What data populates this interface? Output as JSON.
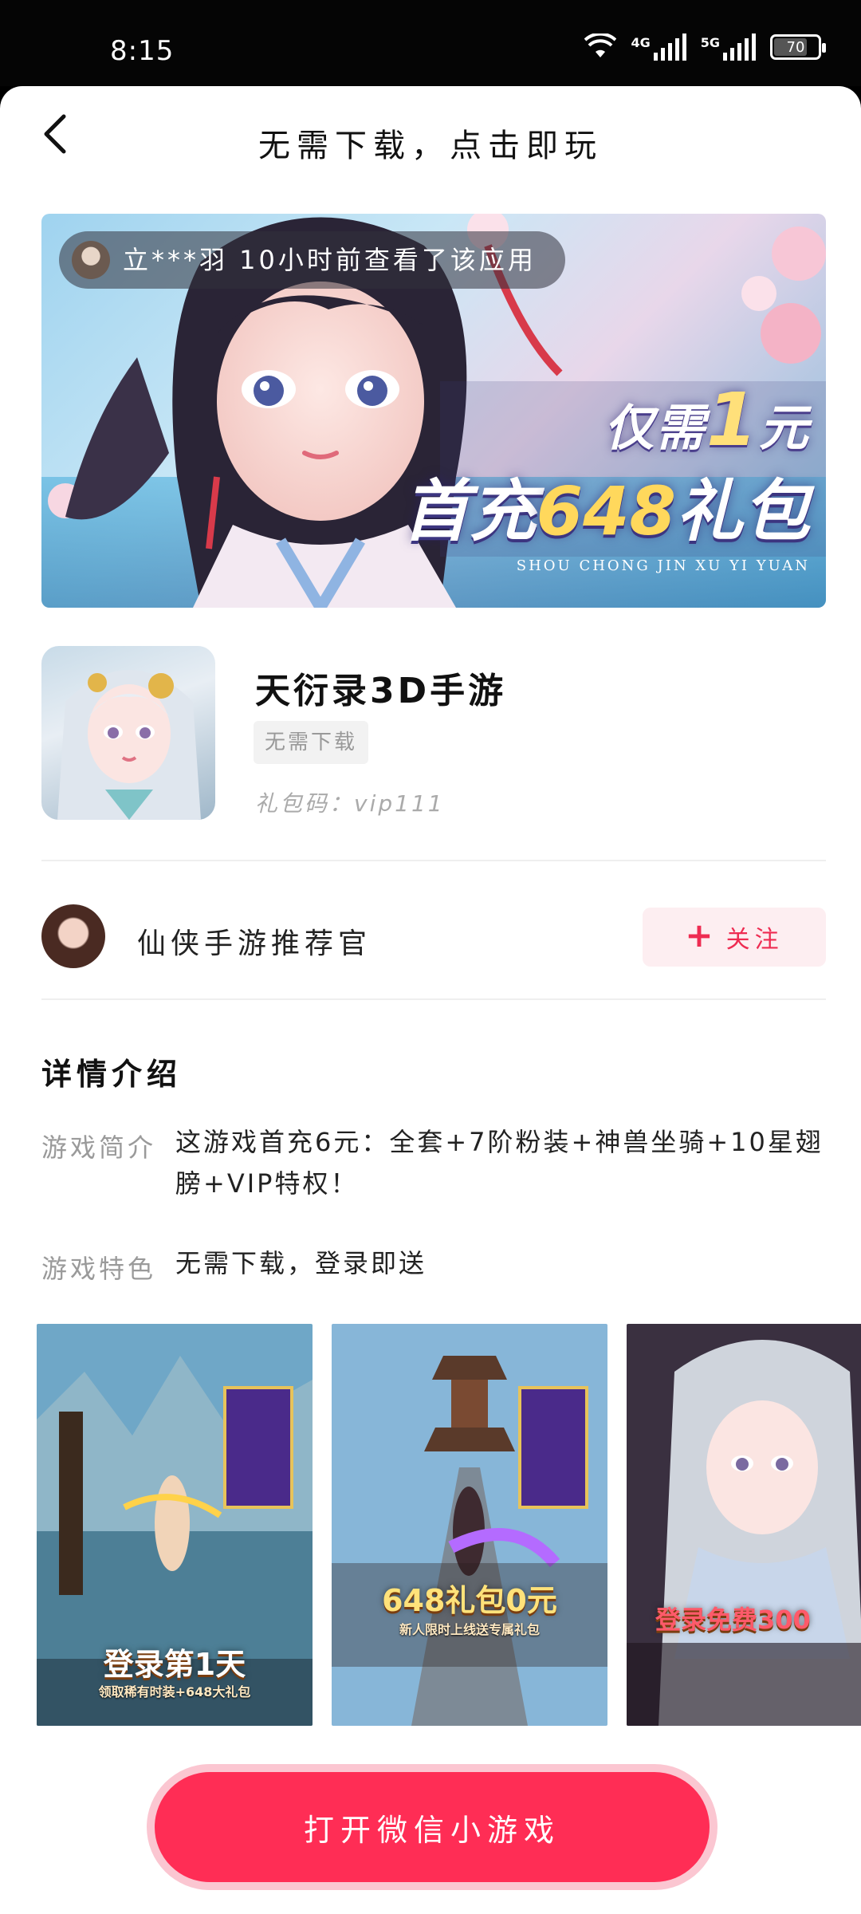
{
  "status_bar": {
    "time": "8:15",
    "network_1": "4G",
    "network_2": "5G",
    "battery": "70"
  },
  "header": {
    "title": "无需下载，点击即玩",
    "back_icon": "chevron-left-icon"
  },
  "banner": {
    "viewer_text": "立***羽 10小时前查看了该应用",
    "promo_prefix": "仅需",
    "promo_amount": "1",
    "promo_unit": "元",
    "promo_main_a": "首充",
    "promo_main_b": "648",
    "promo_main_c": "礼包",
    "promo_pinyin": "SHOU CHONG JIN XU YI YUAN"
  },
  "app": {
    "name": "天衍录3D手游",
    "tag": "无需下载",
    "gift_code": "礼包码：vip111"
  },
  "author": {
    "name": "仙侠手游推荐官",
    "follow_label": "关注"
  },
  "details": {
    "section_title": "详情介绍",
    "intro_label": "游戏简介",
    "intro_value": "这游戏首充6元：全套+7阶粉装+神兽坐骑+10星翅膀+VIP特权！",
    "feature_label": "游戏特色",
    "feature_value": "无需下载，登录即送"
  },
  "screenshots": [
    {
      "caption": "登录第1天",
      "sub": "领取稀有时装+648大礼包"
    },
    {
      "caption": "648礼包0元",
      "sub": "新人限时上线送专属礼包"
    },
    {
      "caption": "登录免费300",
      "sub": ""
    }
  ],
  "cta": {
    "label": "打开微信小游戏"
  },
  "colors": {
    "accent": "#ff2d55",
    "accent_soft": "#fdeef1",
    "cta_ring": "#fbc6d1"
  }
}
